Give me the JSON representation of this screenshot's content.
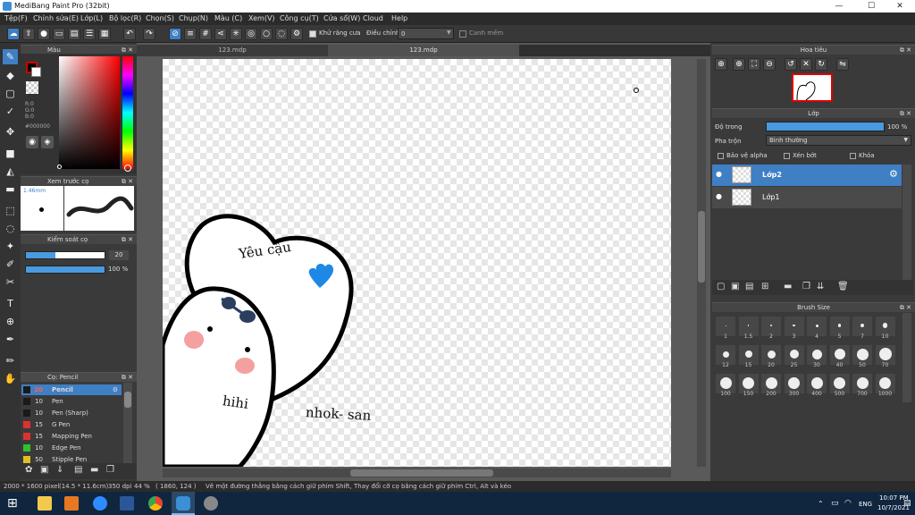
{
  "window": {
    "title": "MediBang Paint Pro (32bit)",
    "minimize": "—",
    "maximize": "☐",
    "close": "✕"
  },
  "menu": [
    "Tệp(F)",
    "Chỉnh sửa(E)",
    "Lớp(L)",
    "Bộ lọc(R)",
    "Chọn(S)",
    "Chụp(N)",
    "Màu (C)",
    "Xem(V)",
    "Công cụ(T)",
    "Cửa sổ(W)",
    "Cloud",
    "Help"
  ],
  "toolbar": {
    "antialias_label": "Khử răng cưa",
    "correction_label": "Điều chỉnh",
    "correction_value": "0",
    "snap_label": "Canh mềm"
  },
  "panels": {
    "color": {
      "title": "Màu",
      "r": "R:0",
      "g": "G:0",
      "b": "B:0",
      "hex": "#000000"
    },
    "brush_preview": {
      "title": "Xem trước cọ",
      "size": "1.46mm"
    },
    "brush_control": {
      "title": "Kiểm soát cọ",
      "size": "20",
      "opacity": "100 %"
    },
    "brush_list": {
      "title": "Cọ: Pencil",
      "items": [
        {
          "size": "20",
          "name": "Pencil",
          "color": "#1a1a1a"
        },
        {
          "size": "10",
          "name": "Pen",
          "color": "#1a1a1a"
        },
        {
          "size": "10",
          "name": "Pen (Sharp)",
          "color": "#1a1a1a"
        },
        {
          "size": "15",
          "name": "G Pen",
          "color": "#e03030"
        },
        {
          "size": "15",
          "name": "Mapping Pen",
          "color": "#e03030"
        },
        {
          "size": "10",
          "name": "Edge Pen",
          "color": "#30c030"
        },
        {
          "size": "50",
          "name": "Stipple Pen",
          "color": "#e0c020"
        }
      ]
    },
    "navigator": {
      "title": "Hoa tiêu"
    },
    "layer": {
      "title": "Lớp",
      "opacity_label": "Độ trong",
      "opacity_value": "100 %",
      "blend_label": "Pha trộn",
      "blend_value": "Bình thường",
      "protect_alpha": "Bảo vệ alpha",
      "clipping": "Xén bớt",
      "lock": "Khóa",
      "layers": [
        "Lớp2",
        "Lớp1"
      ]
    },
    "brush_size": {
      "title": "Brush Size",
      "sizes": [
        "1",
        "1.5",
        "2",
        "3",
        "4",
        "5",
        "7",
        "10",
        "12",
        "15",
        "20",
        "25",
        "30",
        "40",
        "50",
        "70",
        "100",
        "150",
        "200",
        "300",
        "400",
        "500",
        "700",
        "1000"
      ]
    }
  },
  "tabs": [
    "123.mdp",
    "123.mdp"
  ],
  "canvas_text": {
    "t1": "Yêu cậu",
    "t2": "hihi",
    "t3": "nhok- san"
  },
  "status": {
    "size": "2000 * 1600 pixel",
    "cm": "(14.5 * 11.6cm)",
    "dpi": "350 dpi",
    "zoom": "44 %",
    "coords": "( 1860, 124 )",
    "hint": "Vẽ một đường thẳng bằng cách giữ phím Shift, Thay đổi cỡ cọ bằng cách giữ phím Ctrl, Alt và kéo"
  },
  "taskbar": {
    "time": "10:07 PM",
    "date": "10/7/2021",
    "lang": "ENG"
  },
  "colors": {
    "accent": "#3f7fc4",
    "heart_blue": "#1e88e5",
    "blush": "#f4a0a0",
    "glasses": "#2c3e60"
  }
}
